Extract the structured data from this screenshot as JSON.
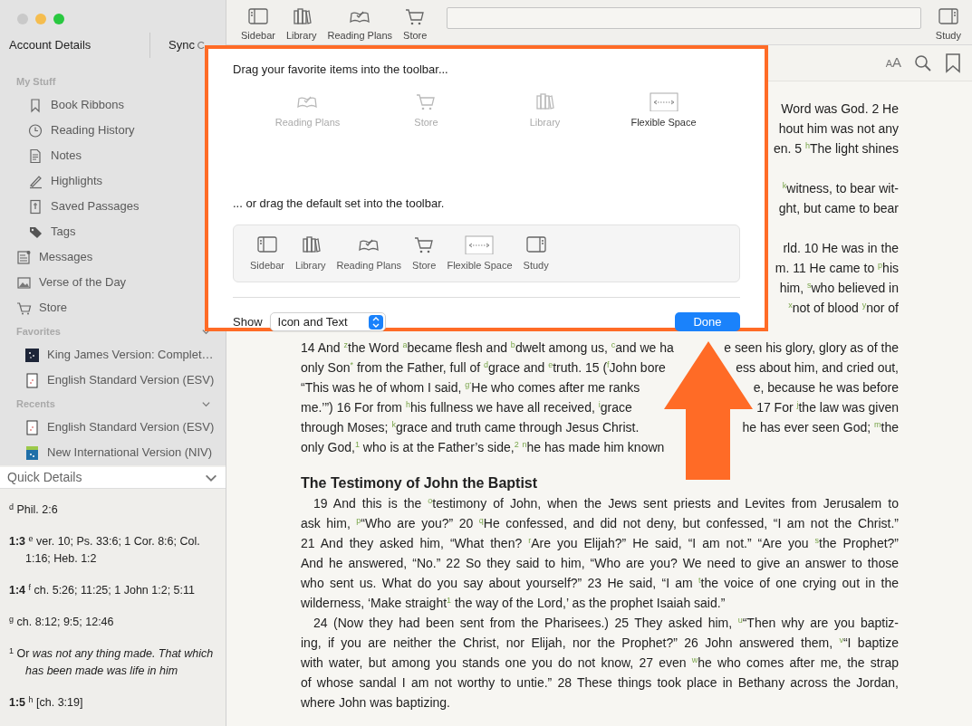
{
  "sidebar": {
    "account_label": "Account Details",
    "sync_label": "Sync",
    "my_stuff": {
      "title": "My Stuff",
      "items": [
        {
          "label": "Book Ribbons",
          "kind": "bookmark"
        },
        {
          "label": "Reading History",
          "kind": "clock"
        },
        {
          "label": "Notes",
          "kind": "note"
        },
        {
          "label": "Highlights",
          "kind": "pen"
        },
        {
          "label": "Saved Passages",
          "kind": "saved"
        },
        {
          "label": "Tags",
          "kind": "tag"
        }
      ]
    },
    "links": [
      {
        "label": "Messages",
        "kind": "messages"
      },
      {
        "label": "Verse of the Day",
        "kind": "picture"
      },
      {
        "label": "Store",
        "kind": "cart"
      }
    ],
    "favorites": {
      "title": "Favorites",
      "expanded": true,
      "items": [
        {
          "label": "King James Version: Complet…",
          "kind": "cover-dark"
        },
        {
          "label": "English Standard Version (ESV)",
          "kind": "cover-white"
        }
      ]
    },
    "recents": {
      "title": "Recents",
      "expanded": true,
      "items": [
        {
          "label": "English Standard Version (ESV)",
          "kind": "cover-white"
        },
        {
          "label": "New International Version (NIV)",
          "kind": "cover-blue"
        }
      ]
    }
  },
  "quick_details": {
    "title": "Quick Details",
    "expanded": true,
    "notes": [
      "$^{d}$ Phil. 2:6",
      "**1:3** $^{e}$ ver. 10; Ps. 33:6; 1 Cor. 8:6; Col. 1:16; Heb. 1:2",
      "**1:4** $^{f}$ ch. 5:26; 11:25; 1 John 1:2; 5:11",
      "$^{g}$ ch. 8:12; 9:5; 12:46",
      "$^{1}$ Or *was not any thing made. That which has been made was life in him*",
      "**1:5** $^{h}$ [ch. 3:19]"
    ]
  },
  "toolbar": {
    "items": [
      {
        "label": "Sidebar",
        "kind": "sidebar"
      },
      {
        "label": "Library",
        "kind": "library"
      },
      {
        "label": "Reading Plans",
        "kind": "plans"
      },
      {
        "label": "Store",
        "kind": "store"
      }
    ],
    "right_items": [
      {
        "label": "Study",
        "kind": "study"
      }
    ]
  },
  "reader_bar": {
    "text_size_label": "AA"
  },
  "reader": {
    "lines": [
      {
        "kind": "right",
        "text": "Word was God. 2 He"
      },
      {
        "kind": "right",
        "text": "hout him was not any"
      },
      {
        "kind": "right",
        "text": "en. 5 $^{h}$The light shines"
      },
      {
        "kind": "gap"
      },
      {
        "kind": "right",
        "text": "$^{k}$witness, to bear wit-"
      },
      {
        "kind": "right",
        "text": "ght, but came to bear"
      },
      {
        "kind": "gap"
      },
      {
        "kind": "right",
        "text": "rld. 10 He was in the"
      },
      {
        "kind": "right",
        "text": "m. 11 He came to $^{p}$his"
      },
      {
        "kind": "right",
        "text": "him, $^{s}$who believed in"
      },
      {
        "kind": "right",
        "text": "$^{x}$not of blood $^{y}$nor of"
      },
      {
        "kind": "gap"
      },
      {
        "kind": "split",
        "left": "14 And $^{z}$the Word $^{a}$became flesh and $^{b}$dwelt among us, $^{c}$and we ha",
        "right": "e seen his glory, glory as of the"
      },
      {
        "kind": "split",
        "left": "only Son$^{*}$ from the Father, full of $^{d}$grace and $^{e}$truth. 15 ($^{f}$John bore",
        "right": "ess about him, and cried out,"
      },
      {
        "kind": "split",
        "left": "“This was he of whom I said, $^{g‘}$He who comes after me ranks",
        "right": "e, because he was before"
      },
      {
        "kind": "split",
        "left": "me.’”) 16 For from $^{h}$his fullness we have all received, $^{i}$grace",
        "right": "17 For $^{j}$the law was given"
      },
      {
        "kind": "split",
        "left": "through Moses; $^{k}$grace and truth came through Jesus Christ.",
        "right": "he has ever seen God; $^{m}$the"
      },
      {
        "kind": "left",
        "text": "only God,$^{1}$ who is at the Father’s side,$^{2}$ $^{n}$he has made him known"
      },
      {
        "kind": "heading",
        "text": "The Testimony of John the Baptist"
      },
      {
        "kind": "first",
        "text": "19 And this is the $^{o}$testimony of John, when the Jews sent priests and Levites from Jerusalem to"
      },
      {
        "kind": "full",
        "text": "ask him, $^{p}$“Who are you?” 20 $^{q}$He confessed, and did not deny, but confessed, “I am not the Christ.”"
      },
      {
        "kind": "full",
        "text": "21 And they asked him, “What then? $^{r}$Are you Elijah?” He said, “I am not.” “Are you $^{s}$the Prophet?”"
      },
      {
        "kind": "full",
        "text": "And he answered, “No.” 22 So they said to him, “Who are you? We need to give an answer to those"
      },
      {
        "kind": "full",
        "text": "who sent us. What do you say about yourself?” 23 He said, “I am $^{t}$the voice of one crying out in the"
      },
      {
        "kind": "end",
        "text": "wilderness, ‘Make straight$^{1}$ the way of the Lord,’ as the prophet Isaiah said.”"
      },
      {
        "kind": "first",
        "text": "24 (Now they had been sent from the Pharisees.) 25 They asked him, $^{u}$“Then why are you baptiz-"
      },
      {
        "kind": "full",
        "text": "ing, if you are neither the Christ, nor Elijah, nor the Prophet?” 26 John answered them, $^{v}$“I baptize"
      },
      {
        "kind": "full",
        "text": "with water, but among you stands one you do not know, 27 even $^{w}$he who comes after me, the strap"
      },
      {
        "kind": "full",
        "text": "of whose sandal I am not worthy to untie.” 28 These things took place in Bethany across the Jordan,"
      },
      {
        "kind": "end",
        "text": "where John was baptizing."
      }
    ]
  },
  "customize_dialog": {
    "intro": "Drag your favorite items into the toolbar...",
    "palette": [
      {
        "label": "Reading Plans",
        "kind": "plans",
        "disabled": true
      },
      {
        "label": "Store",
        "kind": "store",
        "disabled": true
      },
      {
        "label": "Library",
        "kind": "library",
        "disabled": true
      },
      {
        "label": "Flexible Space",
        "kind": "flex",
        "disabled": false
      }
    ],
    "default_intro": "... or drag the default set into the toolbar.",
    "default_set": [
      {
        "label": "Sidebar",
        "kind": "sidebar"
      },
      {
        "label": "Library",
        "kind": "library"
      },
      {
        "label": "Reading Plans",
        "kind": "plans"
      },
      {
        "label": "Store",
        "kind": "store"
      },
      {
        "label": "Flexible Space",
        "kind": "flex"
      },
      {
        "label": "Study",
        "kind": "study"
      }
    ],
    "show_label": "Show",
    "show_value": "Icon and Text",
    "done_label": "Done"
  }
}
